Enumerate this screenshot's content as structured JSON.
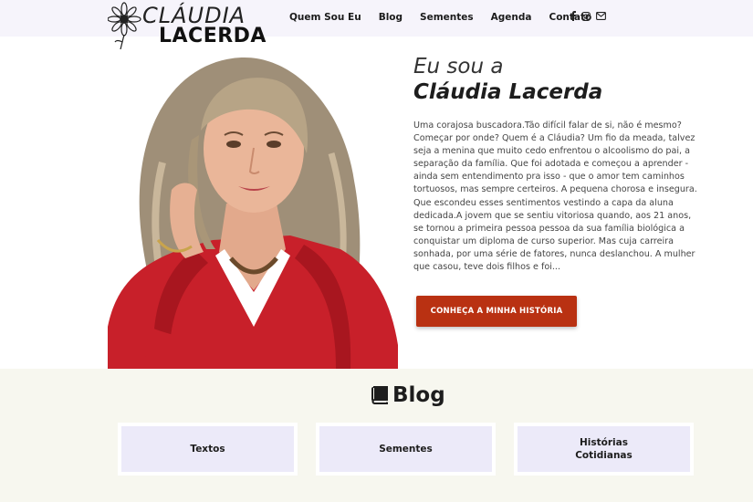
{
  "header": {
    "logo_line1": "CLÁUDIA",
    "logo_line2": "LACERDA",
    "nav": [
      {
        "label": "Quem Sou Eu"
      },
      {
        "label": "Blog"
      },
      {
        "label": "Sementes"
      },
      {
        "label": "Agenda"
      },
      {
        "label": "Contato"
      }
    ],
    "social_icons": [
      "facebook-icon",
      "instagram-icon",
      "email-icon"
    ]
  },
  "hero": {
    "intro_line1": "Eu sou a",
    "intro_line2": "Cláudia Lacerda",
    "bio": "Uma corajosa buscadora.Tão difícil falar de si, não é mesmo? Começar por onde? Quem é a Cláudia? Um fio da meada, talvez seja a menina que muito cedo enfrentou o alcoolismo do pai, a separação da família. Que foi adotada e começou a aprender - ainda sem entendimento pra isso - que o amor tem caminhos tortuosos, mas sempre certeiros. A pequena chorosa e insegura. Que escondeu esses sentimentos vestindo a capa da aluna dedicada.A jovem que se sentiu vitoriosa quando, aos 21 anos, se tornou a primeira pessoa pessoa da sua família biológica a conquistar um diploma de curso superior. Mas cuja carreira sonhada, por uma série de fatores, nunca deslanchou. A mulher que casou, teve dois filhos e foi...",
    "cta_label": "CONHEÇA A MINHA HISTÓRIA",
    "colors": {
      "cta": "#b93112",
      "shirt": "#c8202a"
    }
  },
  "blog": {
    "title": "Blog",
    "cards": [
      {
        "label": "Textos"
      },
      {
        "label": "Sementes"
      },
      {
        "label": "Histórias Cotidianas"
      }
    ]
  }
}
